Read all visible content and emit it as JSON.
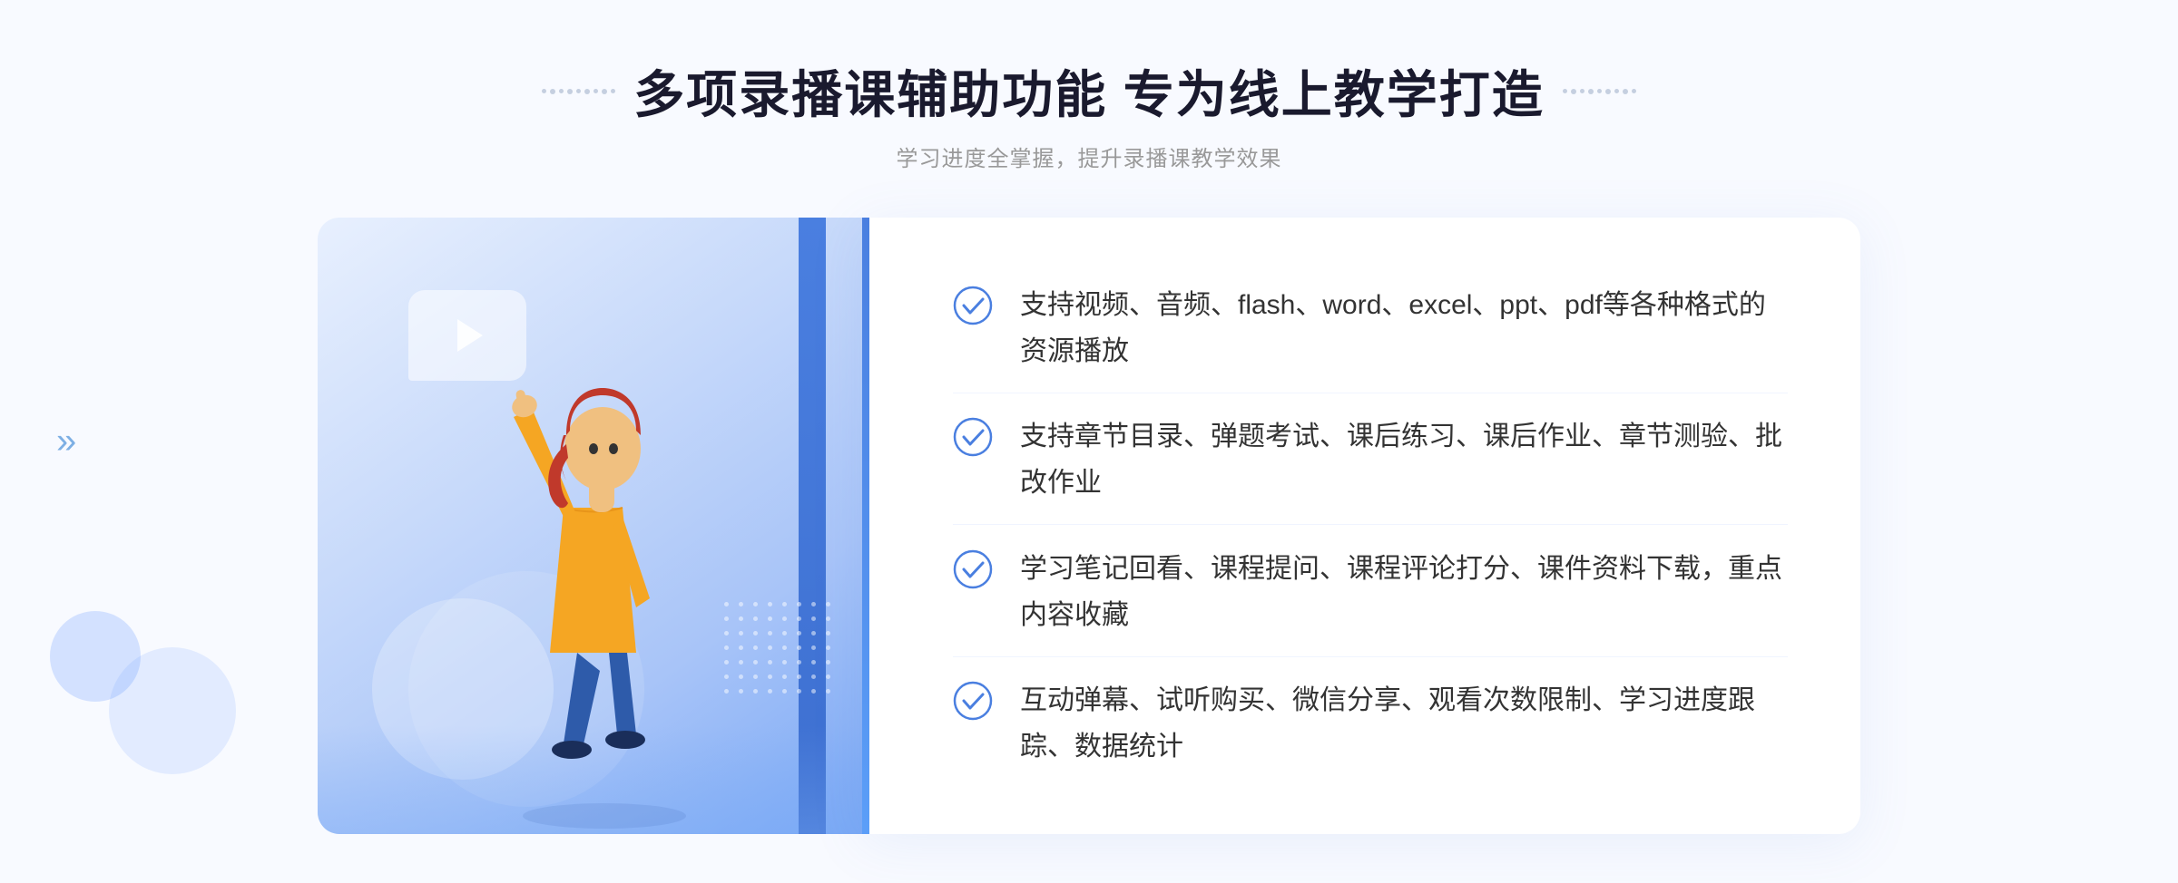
{
  "header": {
    "title": "多项录播课辅助功能 专为线上教学打造",
    "subtitle": "学习进度全掌握，提升录播课教学效果"
  },
  "features": [
    {
      "id": "feature-1",
      "text": "支持视频、音频、flash、word、excel、ppt、pdf等各种格式的资源播放"
    },
    {
      "id": "feature-2",
      "text": "支持章节目录、弹题考试、课后练习、课后作业、章节测验、批改作业"
    },
    {
      "id": "feature-3",
      "text": "学习笔记回看、课程提问、课程评论打分、课件资料下载，重点内容收藏"
    },
    {
      "id": "feature-4",
      "text": "互动弹幕、试听购买、微信分享、观看次数限制、学习进度跟踪、数据统计"
    }
  ],
  "colors": {
    "accent": "#4a7fe0",
    "accent_light": "#7ab0f8",
    "text_primary": "#1a1a2e",
    "text_secondary": "#999",
    "check_color": "#4a7fe0"
  },
  "decoration": {
    "chevron_left": "»",
    "play_icon": "▶"
  }
}
